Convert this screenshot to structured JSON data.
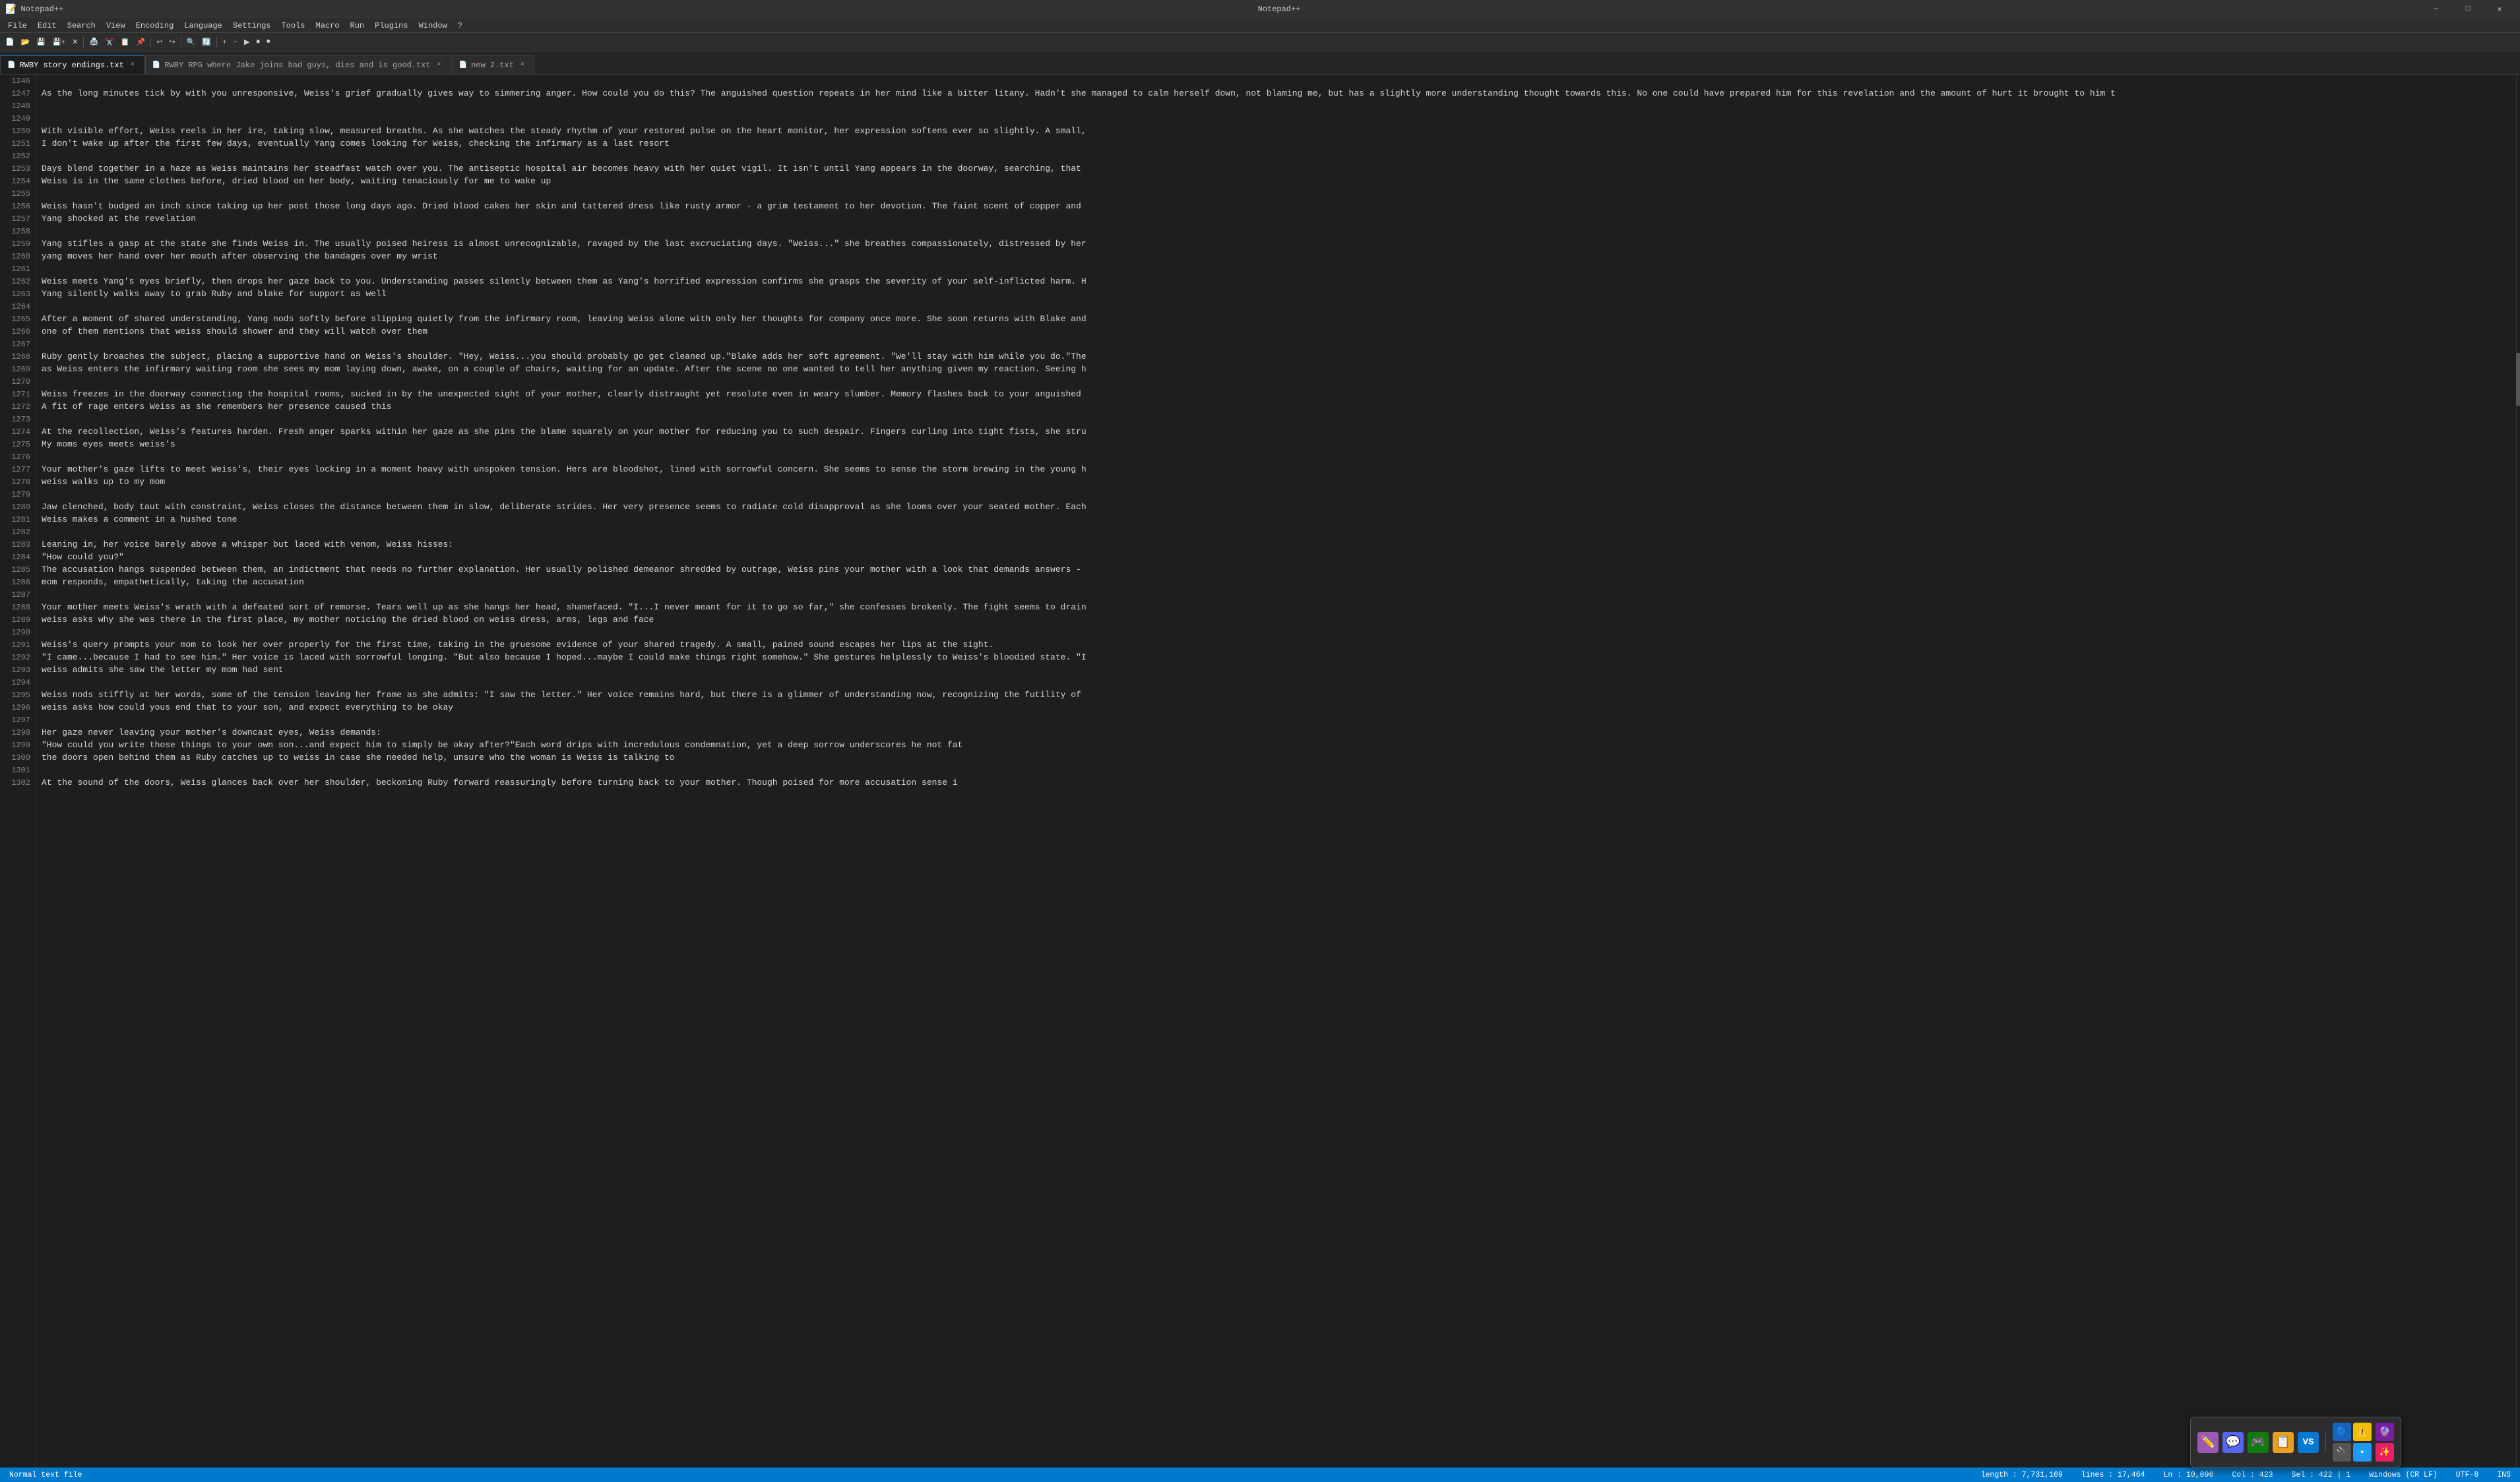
{
  "titleBar": {
    "text": "Notepad++"
  },
  "titleControls": {
    "minimize": "—",
    "maximize": "□",
    "close": "✕"
  },
  "menuBar": {
    "items": [
      "File",
      "Edit",
      "Search",
      "View",
      "Encoding",
      "Language",
      "Settings",
      "Tools",
      "Macro",
      "Run",
      "Plugins",
      "Window",
      "?"
    ]
  },
  "tabs": [
    {
      "label": "RWBY story endings.txt",
      "active": true,
      "icon": "📄",
      "closable": true
    },
    {
      "label": "RWBY RPG where Jake joins bad guys, dies and is good.txt",
      "active": false,
      "icon": "📄",
      "closable": true
    },
    {
      "label": "new 2.txt",
      "active": false,
      "icon": "📄",
      "closable": true
    }
  ],
  "lines": [
    {
      "num": 1246,
      "text": ""
    },
    {
      "num": 1247,
      "text": "As the long minutes tick by with you unresponsive, Weiss's grief gradually gives way to simmering anger. How could you do this? The anguished question repeats in her mind like a bitter litany. Hadn't she managed to calm herself down, not blaming me, but has a slightly more understanding thought towards this. No one could have prepared him for this revelation and the amount of hurt it brought to him t"
    },
    {
      "num": 1248,
      "text": ""
    },
    {
      "num": 1249,
      "text": ""
    },
    {
      "num": 1250,
      "text": "With visible effort, Weiss reels in her ire, taking slow, measured breaths. As she watches the steady rhythm of your restored pulse on the heart monitor, her expression softens ever so slightly. A small,"
    },
    {
      "num": 1251,
      "text": "I don't wake up after the first few days, eventually Yang comes looking for Weiss, checking the infirmary as a last resort"
    },
    {
      "num": 1252,
      "text": ""
    },
    {
      "num": 1253,
      "text": "Days blend together in a haze as Weiss maintains her steadfast watch over you. The antiseptic hospital air becomes heavy with her quiet vigil. It isn't until Yang appears in the doorway, searching, that"
    },
    {
      "num": 1254,
      "text": "Weiss is in the same clothes before, dried blood on her body, waiting tenaciously for me to wake up"
    },
    {
      "num": 1255,
      "text": ""
    },
    {
      "num": 1256,
      "text": "Weiss hasn't budged an inch since taking up her post those long days ago. Dried blood cakes her skin and tattered dress like rusty armor - a grim testament to her devotion. The faint scent of copper and"
    },
    {
      "num": 1257,
      "text": "Yang shocked at the revelation"
    },
    {
      "num": 1258,
      "text": ""
    },
    {
      "num": 1259,
      "text": "Yang stifles a gasp at the state she finds Weiss in. The usually poised heiress is almost unrecognizable, ravaged by the last excruciating days. \"Weiss...\" she breathes compassionately, distressed by her"
    },
    {
      "num": 1260,
      "text": "yang moves her hand over her mouth after observing the bandages over my wrist"
    },
    {
      "num": 1261,
      "text": ""
    },
    {
      "num": 1262,
      "text": "Weiss meets Yang's eyes briefly, then drops her gaze back to you. Understanding passes silently between them as Yang's horrified expression confirms she grasps the severity of your self-inflicted harm. H"
    },
    {
      "num": 1263,
      "text": "Yang silently walks away to grab Ruby and blake for support as well"
    },
    {
      "num": 1264,
      "text": ""
    },
    {
      "num": 1265,
      "text": "After a moment of shared understanding, Yang nods softly before slipping quietly from the infirmary room, leaving Weiss alone with only her thoughts for company once more. She soon returns with Blake and"
    },
    {
      "num": 1266,
      "text": "one of them mentions that weiss should shower and they will watch over them"
    },
    {
      "num": 1267,
      "text": ""
    },
    {
      "num": 1268,
      "text": "Ruby gently broaches the subject, placing a supportive hand on Weiss's shoulder. \"Hey, Weiss...you should probably go get cleaned up.\"Blake adds her soft agreement. \"We'll stay with him while you do.\"The"
    },
    {
      "num": 1269,
      "text": "as Weiss enters the infirmary waiting room she sees my mom laying down, awake, on a couple of chairs, waiting for an update. After the scene no one wanted to tell her anything given my reaction. Seeing h"
    },
    {
      "num": 1270,
      "text": ""
    },
    {
      "num": 1271,
      "text": "Weiss freezes in the doorway connecting the hospital rooms, sucked in by the unexpected sight of your mother, clearly distraught yet resolute even in weary slumber. Memory flashes back to your anguished"
    },
    {
      "num": 1272,
      "text": "A fit of rage enters Weiss as she remembers her presence caused this"
    },
    {
      "num": 1273,
      "text": ""
    },
    {
      "num": 1274,
      "text": "At the recollection, Weiss's features harden. Fresh anger sparks within her gaze as she pins the blame squarely on your mother for reducing you to such despair. Fingers curling into tight fists, she stru"
    },
    {
      "num": 1275,
      "text": "My moms eyes meets weiss's"
    },
    {
      "num": 1276,
      "text": ""
    },
    {
      "num": 1277,
      "text": "Your mother's gaze lifts to meet Weiss's, their eyes locking in a moment heavy with unspoken tension. Hers are bloodshot, lined with sorrowful concern. She seems to sense the storm brewing in the young h"
    },
    {
      "num": 1278,
      "text": "weiss walks up to my mom"
    },
    {
      "num": 1279,
      "text": ""
    },
    {
      "num": 1280,
      "text": "Jaw clenched, body taut with constraint, Weiss closes the distance between them in slow, deliberate strides. Her very presence seems to radiate cold disapproval as she looms over your seated mother. Each"
    },
    {
      "num": 1281,
      "text": "Weiss makes a comment in a hushed tone"
    },
    {
      "num": 1282,
      "text": ""
    },
    {
      "num": 1283,
      "text": "Leaning in, her voice barely above a whisper but laced with venom, Weiss hisses:"
    },
    {
      "num": 1284,
      "text": "\"How could you?\""
    },
    {
      "num": 1285,
      "text": "The accusation hangs suspended between them, an indictment that needs no further explanation. Her usually polished demeanor shredded by outrage, Weiss pins your mother with a look that demands answers - "
    },
    {
      "num": 1286,
      "text": "mom responds, empathetically, taking the accusation"
    },
    {
      "num": 1287,
      "text": ""
    },
    {
      "num": 1288,
      "text": "Your mother meets Weiss's wrath with a defeated sort of remorse. Tears well up as she hangs her head, shamefaced. \"I...I never meant for it to go so far,\" she confesses brokenly. The fight seems to drain"
    },
    {
      "num": 1289,
      "text": "weiss asks why she was there in the first place, my mother noticing the dried blood on weiss dress, arms, legs and face"
    },
    {
      "num": 1290,
      "text": ""
    },
    {
      "num": 1291,
      "text": "Weiss's query prompts your mom to look her over properly for the first time, taking in the gruesome evidence of your shared tragedy. A small, pained sound escapes her lips at the sight."
    },
    {
      "num": 1292,
      "text": "\"I came...because I had to see him.\" Her voice is laced with sorrowful longing. \"But also because I hoped...maybe I could make things right somehow.\" She gestures helplessly to Weiss's bloodied state. \"I"
    },
    {
      "num": 1293,
      "text": "weiss admits she saw the letter my mom had sent"
    },
    {
      "num": 1294,
      "text": ""
    },
    {
      "num": 1295,
      "text": "Weiss nods stiffly at her words, some of the tension leaving her frame as she admits: \"I saw the letter.\" Her voice remains hard, but there is a glimmer of understanding now, recognizing the futility of"
    },
    {
      "num": 1296,
      "text": "weiss asks how could yous end that to your son, and expect everything to be okay"
    },
    {
      "num": 1297,
      "text": ""
    },
    {
      "num": 1298,
      "text": "Her gaze never leaving your mother's downcast eyes, Weiss demands:"
    },
    {
      "num": 1299,
      "text": "\"How could you write those things to your own son...and expect him to simply be okay after?\"Each word drips with incredulous condemnation, yet a deep sorrow underscores he                               not fat"
    },
    {
      "num": 1300,
      "text": "the doors open behind them as Ruby catches up to weiss in case she needed help, unsure who the woman is Weiss is talking to"
    },
    {
      "num": 1301,
      "text": ""
    },
    {
      "num": 1302,
      "text": "At the sound of the doors, Weiss glances back over her shoulder, beckoning Ruby forward reassuringly before turning back to your mother. Though poised for more accusation                                 sense i"
    }
  ],
  "statusBar": {
    "fileType": "Normal text file",
    "length": "length : 7,731,169",
    "lines": "lines : 17,464",
    "ln": "Ln : 10,096",
    "col": "Col : 423",
    "sel": "Sel : 422 | 1",
    "encoding": "Windows (CR LF)",
    "charset": "UTF-8",
    "ins": "INS"
  },
  "taskbarIcons": {
    "row1": [
      "✏️",
      "💬",
      "🎮",
      "📝",
      "💙"
    ],
    "row2": [
      "⚠️",
      "🔌",
      "🔵",
      "🔮"
    ]
  }
}
